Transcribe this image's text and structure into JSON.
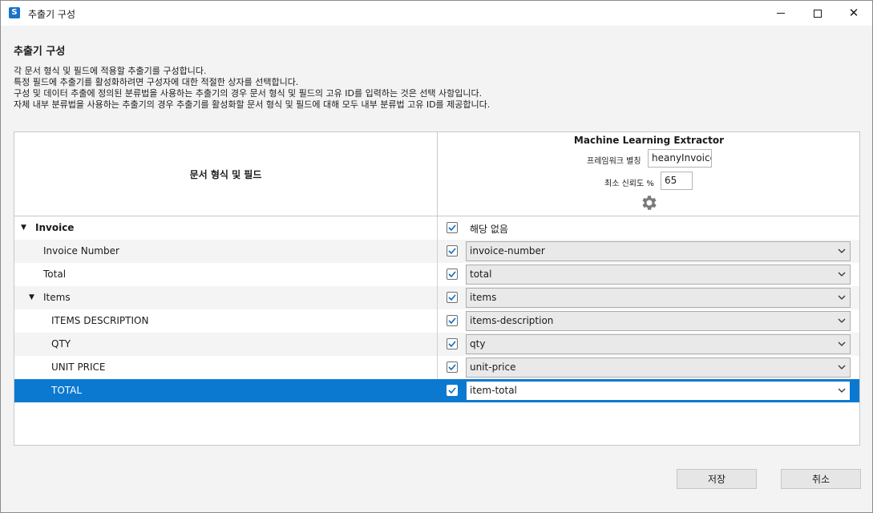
{
  "window": {
    "title": "추출기 구성",
    "app_icon_glyph": "S"
  },
  "heading": "추출기 구성",
  "description": [
    "각 문서 형식 및 필드에 적용할 추출기를 구성합니다.",
    "특정 필드에 추출기를 활성화하려면 구성자에 대한 적절한 상자를 선택합니다.",
    "구성 및 데이터 추출에 정의된 분류법을 사용하는 추출기의 경우 문서 형식 및 필드의 고유 ID를 입력하는 것은 선택 사항입니다.",
    "자체 내부 분류법을 사용하는 추출기의 경우 추출기를 활성화할 문서 형식 및 필드에 대해 모두 내부 분류법 고유 ID를 제공합니다."
  ],
  "grid": {
    "left_header": "문서 형식 및 필드",
    "extractor": {
      "name": "Machine Learning Extractor",
      "alias_label": "프레임워크 별칭",
      "alias_value": "heanyInvoice",
      "confidence_label": "최소 신뢰도 %",
      "confidence_value": "65",
      "settings_icon": "gear-icon"
    },
    "rows": [
      {
        "label": "Invoice",
        "checked": true,
        "value": "해당 없음"
      },
      {
        "label": "Invoice Number",
        "checked": true,
        "value": "invoice-number"
      },
      {
        "label": "Total",
        "checked": true,
        "value": "total"
      },
      {
        "label": "Items",
        "checked": true,
        "value": "items"
      },
      {
        "label": "ITEMS DESCRIPTION",
        "checked": true,
        "value": "items-description"
      },
      {
        "label": "QTY",
        "checked": true,
        "value": "qty"
      },
      {
        "label": "UNIT PRICE",
        "checked": true,
        "value": "unit-price"
      },
      {
        "label": "TOTAL",
        "checked": true,
        "value": "item-total"
      }
    ]
  },
  "buttons": {
    "save": "저장",
    "cancel": "취소"
  },
  "colors": {
    "selection": "#0b79d0",
    "checkbox_check": "#0b6cbd",
    "app_icon": "#1a73c9"
  }
}
